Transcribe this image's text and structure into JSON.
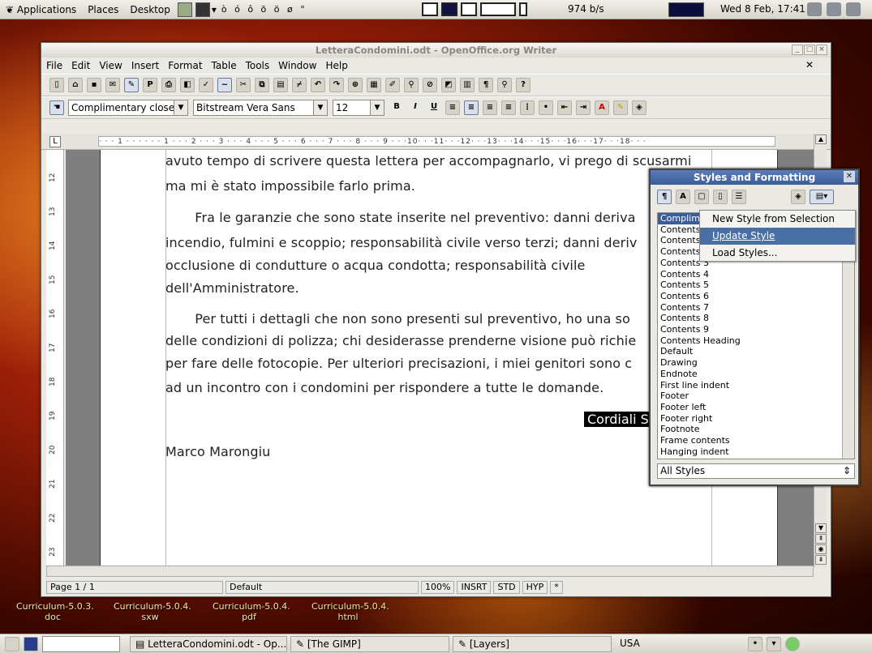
{
  "top_panel": {
    "applications": "Applications",
    "places": "Places",
    "desktop": "Desktop",
    "launcher_chars": "ò ó ô õ ö ø °",
    "netspeed": "974 b/s",
    "clock": "Wed 8 Feb, 17:41"
  },
  "desktop_icons": [
    {
      "label": "Curriculum-5.0.3.\ndoc"
    },
    {
      "label": "Curriculum-5.0.4.\nsxw"
    },
    {
      "label": "Curriculum-5.0.4.\npdf"
    },
    {
      "label": "Curriculum-5.0.4.\nhtml"
    }
  ],
  "window": {
    "title": "LetteraCondomini.odt - OpenOffice.org Writer",
    "menu": [
      "File",
      "Edit",
      "View",
      "Insert",
      "Format",
      "Table",
      "Tools",
      "Window",
      "Help"
    ],
    "style_value": "Complimentary close",
    "font_value": "Bitstream Vera Sans",
    "size_value": "12",
    "ruler_text": "· · · 1 · · ·  · · · 1 · · · 2 · · · 3 · · · 4 · · · 5 · · · 6 · · · 7 · · · 8 · · · 9 · · ·10· · ·11· · ·12· · ·13· · ·14· · ·15· · ·16· · ·17· · ·18· · ·",
    "vruler": [
      "12",
      "13",
      "14",
      "15",
      "16",
      "17",
      "18",
      "19",
      "20",
      "21",
      "22",
      "23"
    ],
    "doc_lines": [
      "avuto tempo di scrivere questa lettera per accompagnarlo, vi prego di scusarmi",
      "ma mi è stato impossibile  farlo prima.",
      "       Fra le garanzie che sono state inserite nel preventivo: danni deriva",
      "incendio, fulmini e scoppio; responsabilità  civile verso terzi; danni deriv",
      "occlusione di condutture o acqua condotta; responsabilità  civile",
      "dell'Amministratore.",
      "       Per tutti i dettagli che non sono presenti sul preventivo, ho una so",
      "delle condizioni di polizza; chi desiderasse prenderne visione può richie",
      "per fare delle fotocopie. Per ulteriori precisazioni, i miei genitori sono c",
      "ad un incontro con i condomini per rispondere a tutte le domande.",
      "Marco Marongiu"
    ],
    "closing": "Cordiali S",
    "status": {
      "page": "Page 1 / 1",
      "style": "Default",
      "zoom": "100%",
      "insrt": "INSRT",
      "std": "STD",
      "hyp": "HYP",
      "mod": "*"
    }
  },
  "styles_panel": {
    "title": "Styles and Formatting",
    "items": [
      "Complimentary close",
      "Contents 1",
      "Contents 2",
      "Contents 3",
      "Contents 3",
      "Contents 4",
      "Contents 5",
      "Contents 6",
      "Contents 7",
      "Contents 8",
      "Contents 9",
      "Contents Heading",
      "Default",
      "Drawing",
      "Endnote",
      "First line indent",
      "Footer",
      "Footer left",
      "Footer right",
      "Footnote",
      "Frame contents",
      "Hanging indent"
    ],
    "filter": "All Styles",
    "menu": [
      "New Style from Selection",
      "Update Style",
      "Load Styles..."
    ]
  },
  "taskbar": {
    "items": [
      "LetteraCondomini.odt - Op...",
      "[The GIMP]",
      "[Layers]"
    ],
    "keyboard": "USA"
  }
}
